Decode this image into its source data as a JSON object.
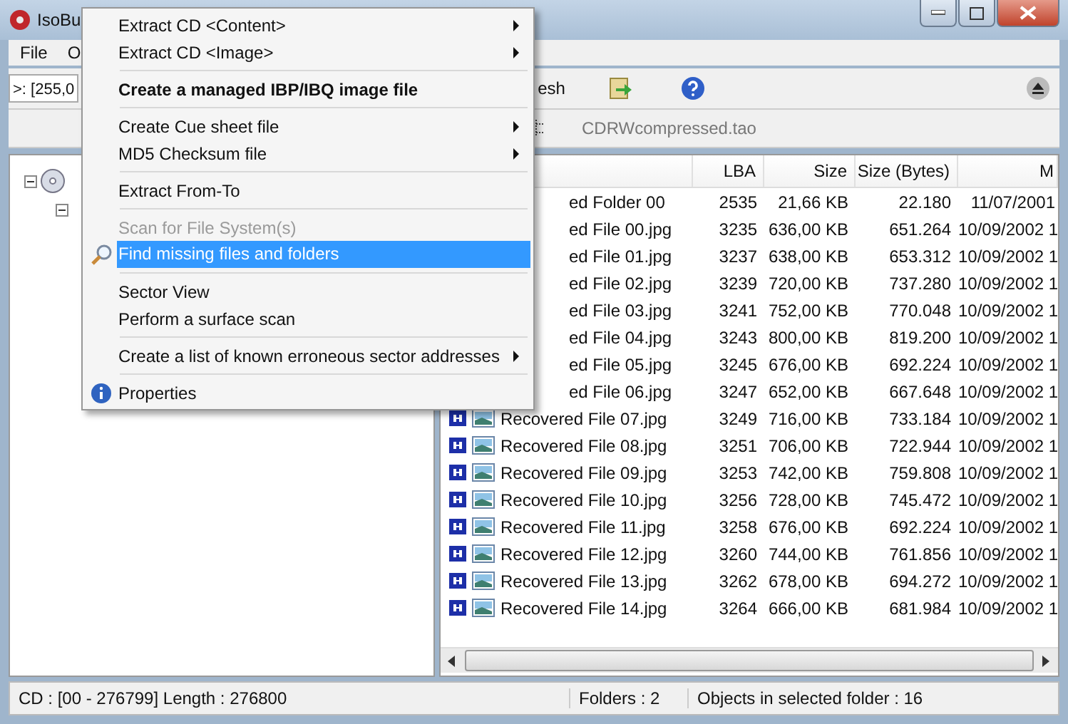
{
  "window": {
    "title": "IsoBu"
  },
  "menu_bar": [
    "File",
    "O"
  ],
  "toolbar": {
    "address": ">: [255,0",
    "refresh_label": "esh"
  },
  "path_bar": {
    "file": "CDRWcompressed.tao"
  },
  "table": {
    "columns": [
      "LBA",
      "Size",
      "Size (Bytes)",
      "M"
    ],
    "rows": [
      {
        "name": "ed Folder 00",
        "icons": false,
        "lba": "2535",
        "size": "21,66 KB",
        "bytes": "22.180",
        "modified": "11/07/2001"
      },
      {
        "name": "ed File 00.jpg",
        "icons": false,
        "lba": "3235",
        "size": "636,00 KB",
        "bytes": "651.264",
        "modified": "10/09/2002 1"
      },
      {
        "name": "ed File 01.jpg",
        "icons": false,
        "lba": "3237",
        "size": "638,00 KB",
        "bytes": "653.312",
        "modified": "10/09/2002 1"
      },
      {
        "name": "ed File 02.jpg",
        "icons": false,
        "lba": "3239",
        "size": "720,00 KB",
        "bytes": "737.280",
        "modified": "10/09/2002 1"
      },
      {
        "name": "ed File 03.jpg",
        "icons": false,
        "lba": "3241",
        "size": "752,00 KB",
        "bytes": "770.048",
        "modified": "10/09/2002 1"
      },
      {
        "name": "ed File 04.jpg",
        "icons": false,
        "lba": "3243",
        "size": "800,00 KB",
        "bytes": "819.200",
        "modified": "10/09/2002 1"
      },
      {
        "name": "ed File 05.jpg",
        "icons": false,
        "lba": "3245",
        "size": "676,00 KB",
        "bytes": "692.224",
        "modified": "10/09/2002 1"
      },
      {
        "name": "ed File 06.jpg",
        "icons": false,
        "lba": "3247",
        "size": "652,00 KB",
        "bytes": "667.648",
        "modified": "10/09/2002 1"
      },
      {
        "name": "Recovered File 07.jpg",
        "icons": true,
        "lba": "3249",
        "size": "716,00 KB",
        "bytes": "733.184",
        "modified": "10/09/2002 1"
      },
      {
        "name": "Recovered File 08.jpg",
        "icons": true,
        "lba": "3251",
        "size": "706,00 KB",
        "bytes": "722.944",
        "modified": "10/09/2002 1"
      },
      {
        "name": "Recovered File 09.jpg",
        "icons": true,
        "lba": "3253",
        "size": "742,00 KB",
        "bytes": "759.808",
        "modified": "10/09/2002 1"
      },
      {
        "name": "Recovered File 10.jpg",
        "icons": true,
        "lba": "3256",
        "size": "728,00 KB",
        "bytes": "745.472",
        "modified": "10/09/2002 1"
      },
      {
        "name": "Recovered File 11.jpg",
        "icons": true,
        "lba": "3258",
        "size": "676,00 KB",
        "bytes": "692.224",
        "modified": "10/09/2002 1"
      },
      {
        "name": "Recovered File 12.jpg",
        "icons": true,
        "lba": "3260",
        "size": "744,00 KB",
        "bytes": "761.856",
        "modified": "10/09/2002 1"
      },
      {
        "name": "Recovered File 13.jpg",
        "icons": true,
        "lba": "3262",
        "size": "678,00 KB",
        "bytes": "694.272",
        "modified": "10/09/2002 1"
      },
      {
        "name": "Recovered File 14.jpg",
        "icons": true,
        "lba": "3264",
        "size": "666,00 KB",
        "bytes": "681.984",
        "modified": "10/09/2002 1"
      }
    ]
  },
  "context_menu": [
    {
      "kind": "item",
      "label": "Extract CD  <Content>",
      "submenu": true,
      "bold": false,
      "disabled": false,
      "selected": false
    },
    {
      "kind": "item",
      "label": "Extract CD  <Image>",
      "submenu": true,
      "bold": false,
      "disabled": false,
      "selected": false
    },
    {
      "kind": "separator"
    },
    {
      "kind": "item",
      "label": "Create a managed IBP/IBQ image file",
      "submenu": false,
      "bold": true,
      "disabled": false,
      "selected": false
    },
    {
      "kind": "separator"
    },
    {
      "kind": "item",
      "label": "Create Cue sheet file",
      "submenu": true,
      "bold": false,
      "disabled": false,
      "selected": false
    },
    {
      "kind": "item",
      "label": "MD5 Checksum file",
      "submenu": true,
      "bold": false,
      "disabled": false,
      "selected": false
    },
    {
      "kind": "separator"
    },
    {
      "kind": "item",
      "label": "Extract From-To",
      "submenu": false,
      "bold": false,
      "disabled": false,
      "selected": false
    },
    {
      "kind": "separator"
    },
    {
      "kind": "item",
      "label": "Scan for File System(s)",
      "submenu": false,
      "bold": false,
      "disabled": true,
      "selected": false
    },
    {
      "kind": "search",
      "label": "Find missing files and folders",
      "submenu": false,
      "bold": false,
      "disabled": false,
      "selected": true
    },
    {
      "kind": "separator"
    },
    {
      "kind": "item",
      "label": "Sector View",
      "submenu": false,
      "bold": false,
      "disabled": false,
      "selected": false
    },
    {
      "kind": "item",
      "label": "Perform a surface scan",
      "submenu": false,
      "bold": false,
      "disabled": false,
      "selected": false
    },
    {
      "kind": "separator"
    },
    {
      "kind": "item",
      "label": "Create a list of known erroneous sector addresses",
      "submenu": true,
      "bold": false,
      "disabled": false,
      "selected": false
    },
    {
      "kind": "separator"
    },
    {
      "kind": "info",
      "label": "Properties",
      "submenu": false,
      "bold": false,
      "disabled": false,
      "selected": false
    }
  ],
  "status_bar": [
    "CD : [00 - 276799]  Length : 276800",
    "Folders : 2",
    "Objects in selected folder : 16"
  ]
}
